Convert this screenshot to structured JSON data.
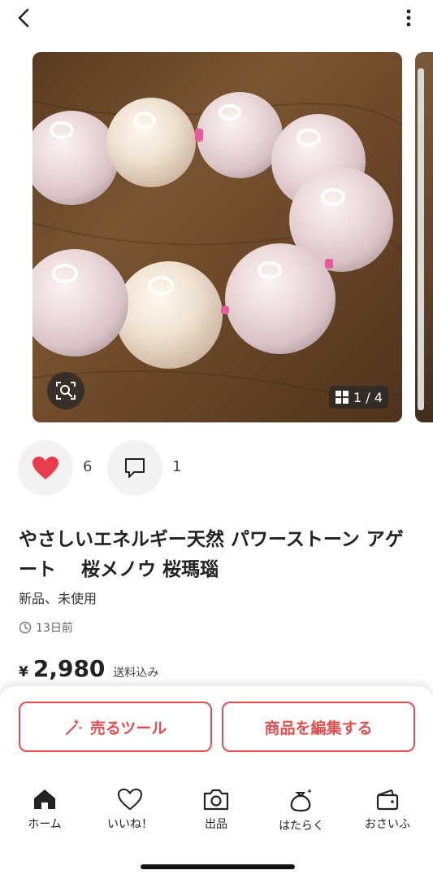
{
  "carousel": {
    "counter_text": "1 / 4"
  },
  "engagement": {
    "like_count": "6",
    "comment_count": "1"
  },
  "item": {
    "title": "やさしいエネルギー天然 パワーストーン アゲート　 桜メノウ 桜瑪瑙",
    "condition": "新品、未使用",
    "posted": "13日前",
    "price_symbol": "¥",
    "price": "2,980",
    "shipping": "送料込み"
  },
  "actions": {
    "sell_tool_label": "売るツール",
    "edit_label": "商品を編集する"
  },
  "tabs": [
    {
      "label": "ホーム",
      "icon": "home-icon"
    },
    {
      "label": "いいね！",
      "icon": "heart-outline-icon"
    },
    {
      "label": "出品",
      "icon": "camera-icon"
    },
    {
      "label": "はたらく",
      "icon": "bag-sparkle-icon"
    },
    {
      "label": "おさいふ",
      "icon": "wallet-icon"
    }
  ],
  "colors": {
    "accent": "#e24e4e",
    "like": "#ea3c4b"
  }
}
